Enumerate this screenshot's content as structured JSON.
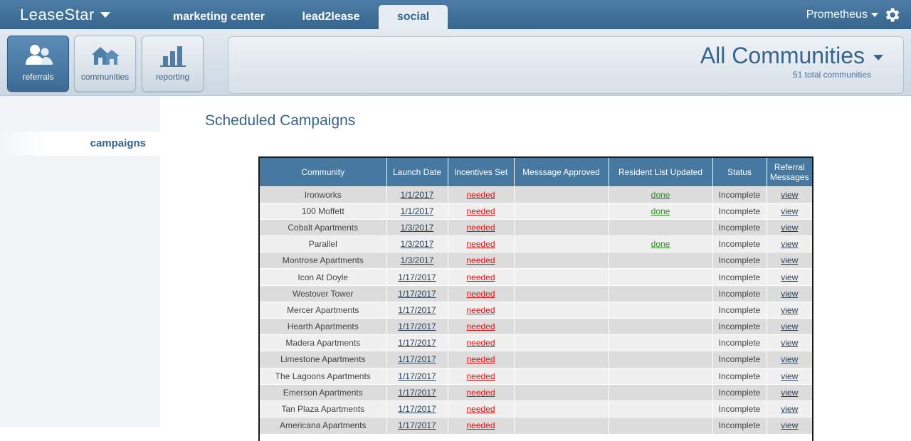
{
  "app": {
    "logo": "LeaseStar"
  },
  "tabs": [
    {
      "label": "marketing center"
    },
    {
      "label": "lead2lease"
    },
    {
      "label": "social"
    }
  ],
  "user": {
    "name": "Prometheus"
  },
  "nav": [
    {
      "label": "referrals"
    },
    {
      "label": "communities"
    },
    {
      "label": "reporting"
    }
  ],
  "community": {
    "title": "All Communities",
    "subtitle": "51 total communities"
  },
  "sidebar": {
    "items": [
      {
        "label": "campaigns"
      }
    ]
  },
  "page": {
    "title": "Scheduled Campaigns"
  },
  "colors": {
    "brand": "#47789f",
    "needed": "#dd1111",
    "done": "#2d8a1f"
  },
  "table": {
    "headers": [
      "Community",
      "Launch Date",
      "Incentives Set",
      "Messsage Approved",
      "Resident List Updated",
      "Status",
      "Referral Messages"
    ],
    "rows": [
      {
        "community": "Ironworks",
        "launch": "1/1/2017",
        "incentives": "needed",
        "approved": "",
        "resident": "done",
        "status": "Incomplete",
        "messages": "view"
      },
      {
        "community": "100 Moffett",
        "launch": "1/1/2017",
        "incentives": "needed",
        "approved": "",
        "resident": "done",
        "status": "Incomplete",
        "messages": "view"
      },
      {
        "community": "Cobalt Apartments",
        "launch": "1/3/2017",
        "incentives": "needed",
        "approved": "",
        "resident": "",
        "status": "Incomplete",
        "messages": "view"
      },
      {
        "community": "Parallel",
        "launch": "1/3/2017",
        "incentives": "needed",
        "approved": "",
        "resident": "done",
        "status": "Incomplete",
        "messages": "view"
      },
      {
        "community": "Montrose Apartments",
        "launch": "1/3/2017",
        "incentives": "needed",
        "approved": "",
        "resident": "",
        "status": "Incomplete",
        "messages": "view"
      },
      {
        "community": "Icon At Doyle",
        "launch": "1/17/2017",
        "incentives": "needed",
        "approved": "",
        "resident": "",
        "status": "Incomplete",
        "messages": "view"
      },
      {
        "community": "Westover Tower",
        "launch": "1/17/2017",
        "incentives": "needed",
        "approved": "",
        "resident": "",
        "status": "Incomplete",
        "messages": "view"
      },
      {
        "community": "Mercer Apartments",
        "launch": "1/17/2017",
        "incentives": "needed",
        "approved": "",
        "resident": "",
        "status": "Incomplete",
        "messages": "view"
      },
      {
        "community": "Hearth Apartments",
        "launch": "1/17/2017",
        "incentives": "needed",
        "approved": "",
        "resident": "",
        "status": "Incomplete",
        "messages": "view"
      },
      {
        "community": "Madera Apartments",
        "launch": "1/17/2017",
        "incentives": "needed",
        "approved": "",
        "resident": "",
        "status": "Incomplete",
        "messages": "view"
      },
      {
        "community": "Limestone Apartments",
        "launch": "1/17/2017",
        "incentives": "needed",
        "approved": "",
        "resident": "",
        "status": "Incomplete",
        "messages": "view"
      },
      {
        "community": "The Lagoons Apartments",
        "launch": "1/17/2017",
        "incentives": "needed",
        "approved": "",
        "resident": "",
        "status": "Incomplete",
        "messages": "view"
      },
      {
        "community": "Emerson Apartments",
        "launch": "1/17/2017",
        "incentives": "needed",
        "approved": "",
        "resident": "",
        "status": "Incomplete",
        "messages": "view"
      },
      {
        "community": "Tan Plaza Apartments",
        "launch": "1/17/2017",
        "incentives": "needed",
        "approved": "",
        "resident": "",
        "status": "Incomplete",
        "messages": "view"
      },
      {
        "community": "Americana Apartments",
        "launch": "1/17/2017",
        "incentives": "needed",
        "approved": "",
        "resident": "",
        "status": "Incomplete",
        "messages": "view"
      }
    ]
  }
}
